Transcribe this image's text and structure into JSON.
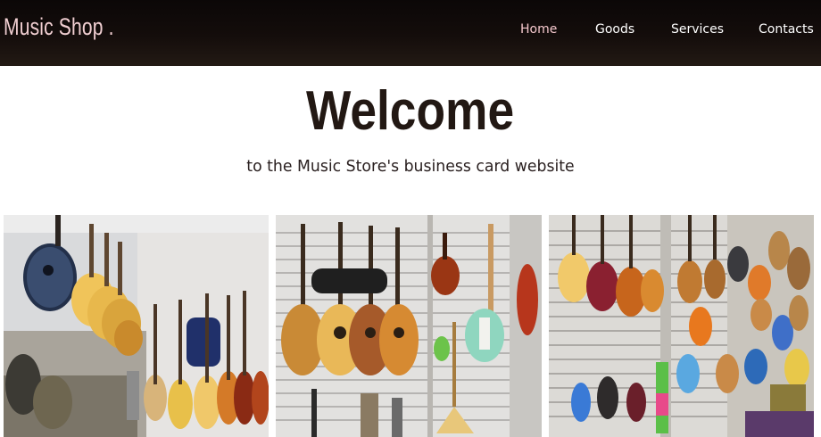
{
  "header": {
    "logo": "Music Shop .",
    "nav": [
      {
        "label": "Home",
        "active": true
      },
      {
        "label": "Goods",
        "active": false
      },
      {
        "label": "Services",
        "active": false
      },
      {
        "label": "Contacts",
        "active": false
      }
    ]
  },
  "hero": {
    "title": "Welcome",
    "subtitle": "to the Music Store's business card website"
  },
  "gallery": {
    "photos": [
      {
        "label": "guitars-on-wall-photo"
      },
      {
        "label": "guitars-and-violin-photo"
      },
      {
        "label": "ukuleles-wall-photo"
      }
    ]
  },
  "colors": {
    "header_bg": "#0b0707",
    "logo": "#f1cfd2",
    "nav_active": "#f4c7cc",
    "nav": "#ffffff",
    "title": "#221813"
  }
}
